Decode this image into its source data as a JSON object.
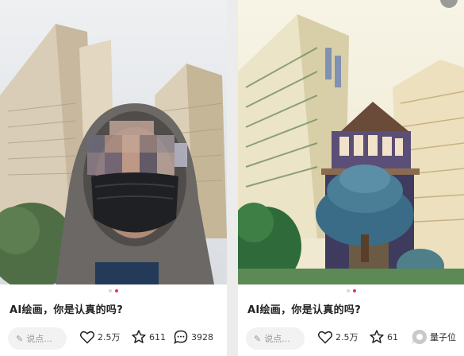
{
  "left_post": {
    "caption": "AI绘画，你是认真的吗?",
    "input_placeholder": "说点...",
    "likes": "2.5万",
    "stars": "611",
    "comments": "3928"
  },
  "right_post": {
    "caption": "AI绘画，你是认真的吗?",
    "input_placeholder": "说点...",
    "likes": "2.5万",
    "stars": "61",
    "comments": ""
  },
  "watermark": {
    "text": "量子位"
  },
  "icons": [
    "pencil-icon",
    "heart-icon",
    "star-icon",
    "comment-icon",
    "more-icon"
  ],
  "colors": {
    "active_dot": "#ff2e4d",
    "inactive_dot": "#d7d7d7",
    "background": "#ececec"
  }
}
